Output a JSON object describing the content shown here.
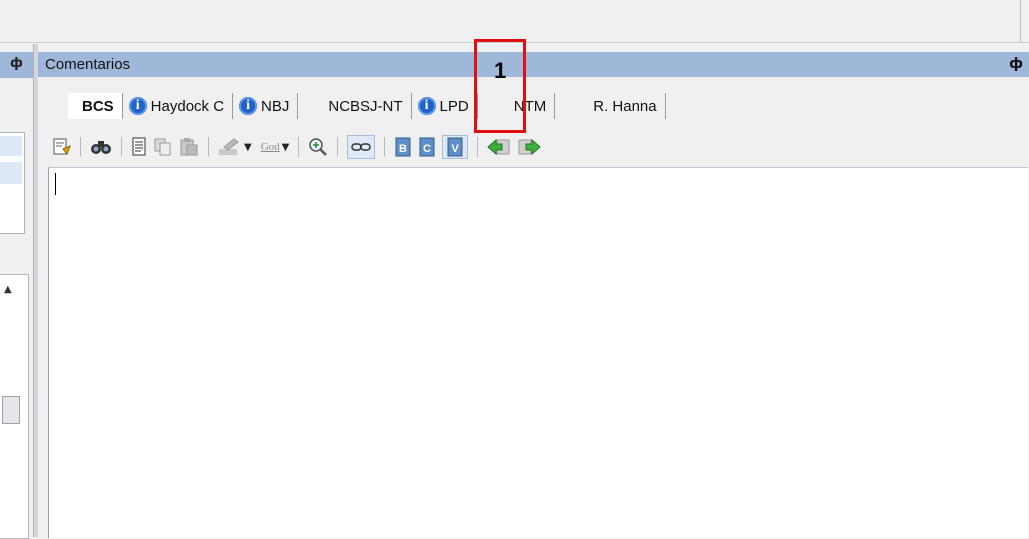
{
  "panel": {
    "title": "Comentarios",
    "pin_glyph": "ф"
  },
  "left_panel": {
    "pin_glyph": "ф",
    "scroll_up_glyph": "▲"
  },
  "tabs": [
    {
      "label": "BCS",
      "active": true,
      "info_icon": false
    },
    {
      "label": "Haydock C",
      "active": false,
      "info_icon": true
    },
    {
      "label": "NBJ",
      "active": false,
      "info_icon": true
    },
    {
      "label": "NCBSJ-NT",
      "active": false,
      "info_icon": false
    },
    {
      "label": "LPD",
      "active": false,
      "info_icon": true
    },
    {
      "label": "NTM",
      "active": false,
      "info_icon": false
    },
    {
      "label": "R. Hanna",
      "active": false,
      "info_icon": false
    }
  ],
  "info_glyph": "i",
  "toolbar": {
    "god_label": "God",
    "dropdown_glyph": "▼",
    "buttons": [
      {
        "name": "edit-properties-icon"
      },
      {
        "name": "find-icon"
      },
      {
        "name": "document-icon"
      },
      {
        "name": "copy-icon"
      },
      {
        "name": "paste-icon"
      },
      {
        "name": "highlight-icon"
      },
      {
        "name": "god-strikethrough-icon"
      },
      {
        "name": "zoom-icon"
      },
      {
        "name": "link-icon"
      },
      {
        "name": "book-b-icon",
        "letter": "B"
      },
      {
        "name": "book-c-icon",
        "letter": "C"
      },
      {
        "name": "book-v-icon",
        "letter": "V",
        "active": true
      },
      {
        "name": "back-icon"
      },
      {
        "name": "forward-icon"
      }
    ]
  },
  "annotation": {
    "label": "1",
    "color": "#e01010"
  },
  "colors": {
    "header_bg": "#9fb8d9",
    "info_blue": "#1f62c8"
  }
}
